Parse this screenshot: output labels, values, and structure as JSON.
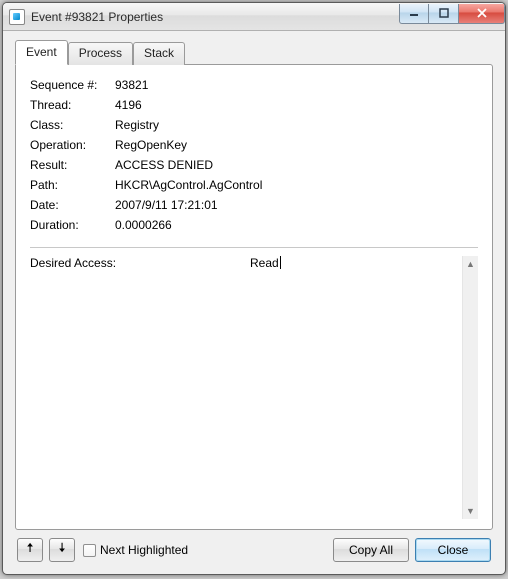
{
  "window": {
    "title": "Event #93821 Properties"
  },
  "tabs": {
    "event": "Event",
    "process": "Process",
    "stack": "Stack"
  },
  "summary": {
    "labels": {
      "sequence": "Sequence #:",
      "thread": "Thread:",
      "class": "Class:",
      "operation": "Operation:",
      "result": "Result:",
      "path": "Path:",
      "date": "Date:",
      "duration": "Duration:"
    },
    "values": {
      "sequence": "93821",
      "thread": "4196",
      "class": "Registry",
      "operation": "RegOpenKey",
      "result": "ACCESS DENIED",
      "path": "HKCR\\AgControl.AgControl",
      "date": "2007/9/11 17:21:01",
      "duration": "0.0000266"
    }
  },
  "detail": {
    "label": "Desired Access:",
    "value": "Read"
  },
  "bottom": {
    "next_highlighted": "Next Highlighted",
    "copy_all": "Copy All",
    "close": "Close"
  }
}
